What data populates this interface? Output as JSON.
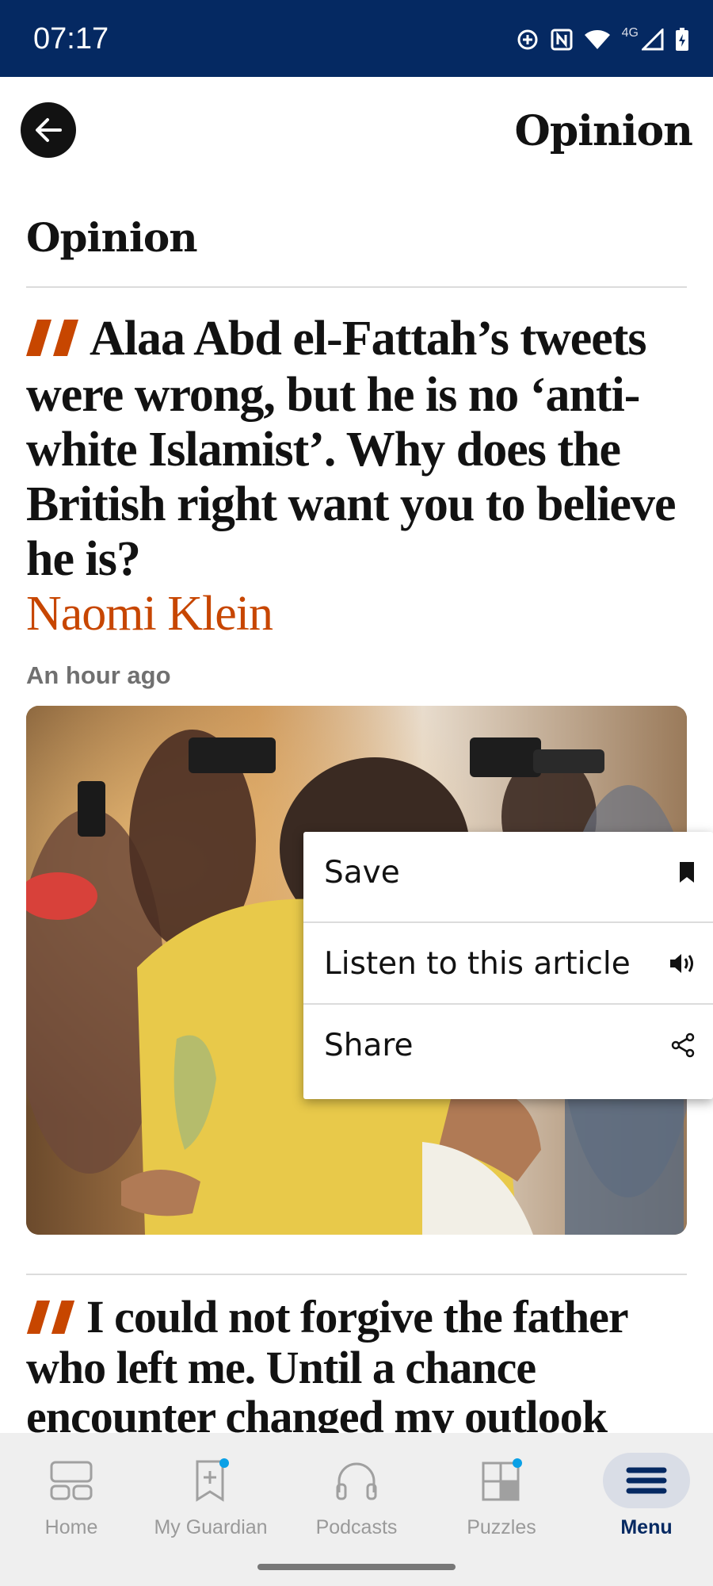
{
  "status_bar": {
    "time": "07:17",
    "network_label": "4G",
    "icons": [
      "data-saver-icon",
      "nfc-icon",
      "wifi-icon",
      "signal-icon",
      "battery-icon"
    ],
    "background_color": "#052962"
  },
  "header": {
    "back_icon": "arrow-left-icon",
    "title": "Opinion"
  },
  "section": {
    "heading": "Opinion"
  },
  "articles": [
    {
      "headline": "Alaa Abd el-Fattah’s tweets were wrong, but he is no ‘anti-white Islamist’. Why does the British right want you to believe he is?",
      "byline": "Naomi Klein",
      "timestamp": "An hour ago",
      "quote_color": "#c74600"
    },
    {
      "headline": "I could not forgive the father who left me. Until a chance encounter changed my outlook"
    }
  ],
  "context_menu": {
    "items": [
      {
        "label": "Save",
        "icon": "bookmark-icon"
      },
      {
        "label": "Listen to this article",
        "icon": "speaker-icon"
      },
      {
        "label": "Share",
        "icon": "share-icon"
      }
    ]
  },
  "bottom_nav": {
    "items": [
      {
        "label": "Home",
        "icon": "home-icon",
        "active": false
      },
      {
        "label": "My Guardian",
        "icon": "my-guardian-icon",
        "active": false,
        "badge": true
      },
      {
        "label": "Podcasts",
        "icon": "headphones-icon",
        "active": false
      },
      {
        "label": "Puzzles",
        "icon": "puzzles-icon",
        "active": false,
        "badge": true
      },
      {
        "label": "Menu",
        "icon": "menu-icon",
        "active": true
      }
    ],
    "active_color": "#052962",
    "badge_color": "#0aa0e6"
  }
}
